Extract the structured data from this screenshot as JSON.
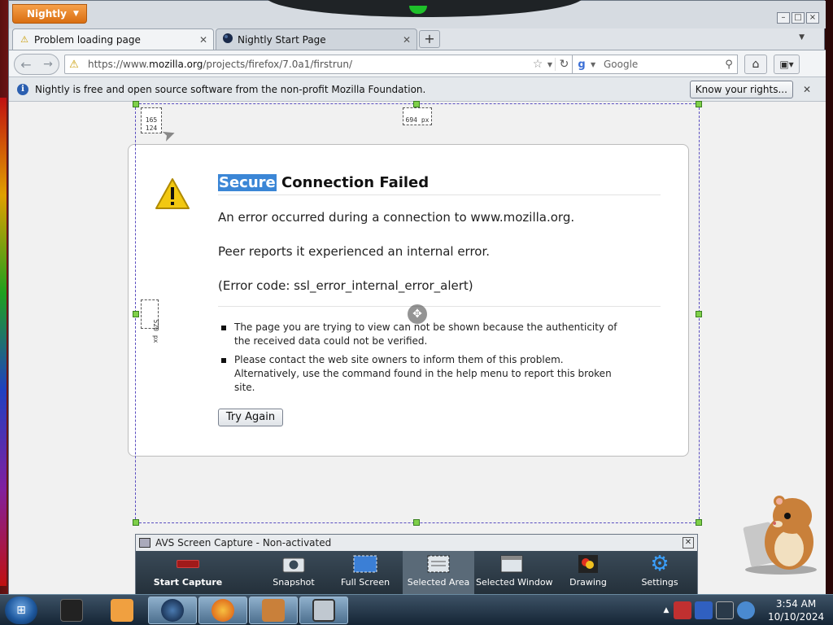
{
  "browser": {
    "app_button": "Nightly",
    "tabs": [
      {
        "title": "Problem loading page",
        "active": true
      },
      {
        "title": "Nightly Start Page",
        "active": false
      }
    ],
    "url": {
      "prefix": "https://www.",
      "domain": "mozilla.org",
      "path": "/projects/firefox/7.0a1/firstrun/"
    },
    "search_placeholder": "Google",
    "notification": {
      "text": "Nightly is free and open source software from the non-profit Mozilla Foundation.",
      "button": "Know your rights..."
    }
  },
  "error_page": {
    "title_highlight": "Secure",
    "title_rest": " Connection Failed",
    "line1": "An error occurred during a connection to www.mozilla.org.",
    "line2": "Peer reports it experienced an internal error.",
    "line3": "(Error code: ssl_error_internal_error_alert)",
    "bullets": [
      "The page you are trying to view can not be shown because the authenticity of the received data could not be verified.",
      "Please contact the web site owners to inform them of this problem. Alternatively, use the command found in the help menu to report this broken site."
    ],
    "button": "Try Again"
  },
  "capture_overlay": {
    "pos_x": "165",
    "pos_y": "124",
    "width": "694 px",
    "height": "520 px"
  },
  "avs_panel": {
    "title": "AVS Screen Capture - Non-activated",
    "items": [
      {
        "label": "Start Capture",
        "icon": "record-icon"
      },
      {
        "label": "Snapshot",
        "icon": "camera-icon"
      },
      {
        "label": "Full Screen",
        "icon": "fullscreen-icon"
      },
      {
        "label": "Selected Area",
        "icon": "selected-area-icon",
        "selected": true
      },
      {
        "label": "Selected Window",
        "icon": "window-icon"
      },
      {
        "label": "Drawing",
        "icon": "drawing-icon"
      },
      {
        "label": "Settings",
        "icon": "gear-icon"
      }
    ]
  },
  "taskbar": {
    "time": "3:54 AM",
    "date": "10/10/2024"
  },
  "colors": {
    "nightly_orange": "#e07a1f",
    "selection_highlight": "#3b86d6",
    "avs_dark": "#283540"
  }
}
